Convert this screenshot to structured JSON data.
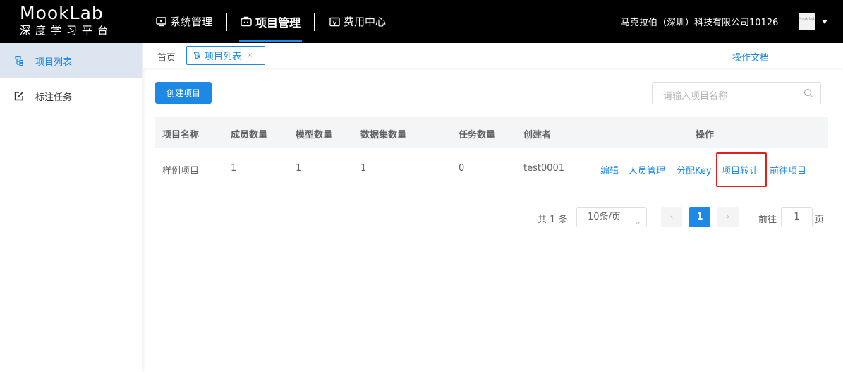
{
  "header": {
    "logo_title": "MookLab",
    "logo_subtitle": "深度学习平台",
    "nav": [
      {
        "label": "系统管理",
        "icon": "monitor-icon"
      },
      {
        "label": "项目管理",
        "icon": "briefcase-icon"
      },
      {
        "label": "费用中心",
        "icon": "finance-icon"
      }
    ],
    "company": "马克拉伯（深圳）科技有限公司10126",
    "avatar_text": "Mook Lab"
  },
  "sidebar": {
    "items": [
      {
        "label": "项目列表",
        "icon": "list-icon"
      },
      {
        "label": "标注任务",
        "icon": "edit-icon"
      }
    ]
  },
  "tabs": {
    "home": "首页",
    "current": "项目列表",
    "close": "×",
    "docs": "操作文档"
  },
  "main": {
    "create_button": "创建项目",
    "search_placeholder": "请输入项目名称"
  },
  "table": {
    "headers": [
      "项目名称",
      "成员数量",
      "模型数量",
      "数据集数量",
      "任务数量",
      "创建者",
      "操作"
    ],
    "rows": [
      {
        "name": "样例项目",
        "members": "1",
        "models": "1",
        "datasets": "1",
        "tasks": "0",
        "creator": "test0001",
        "actions": [
          "编辑",
          "人员管理",
          "分配Key",
          "项目转让",
          "前往项目"
        ]
      }
    ]
  },
  "pagination": {
    "total": "共 1 条",
    "page_size": "10条/页",
    "prev": "‹",
    "current": "1",
    "next": "›",
    "goto_label": "前往",
    "goto_value": "1",
    "page_suffix": "页"
  },
  "colors": {
    "accent": "#1e88e5",
    "highlight_box": "#e02020",
    "header_bg": "#000000"
  }
}
